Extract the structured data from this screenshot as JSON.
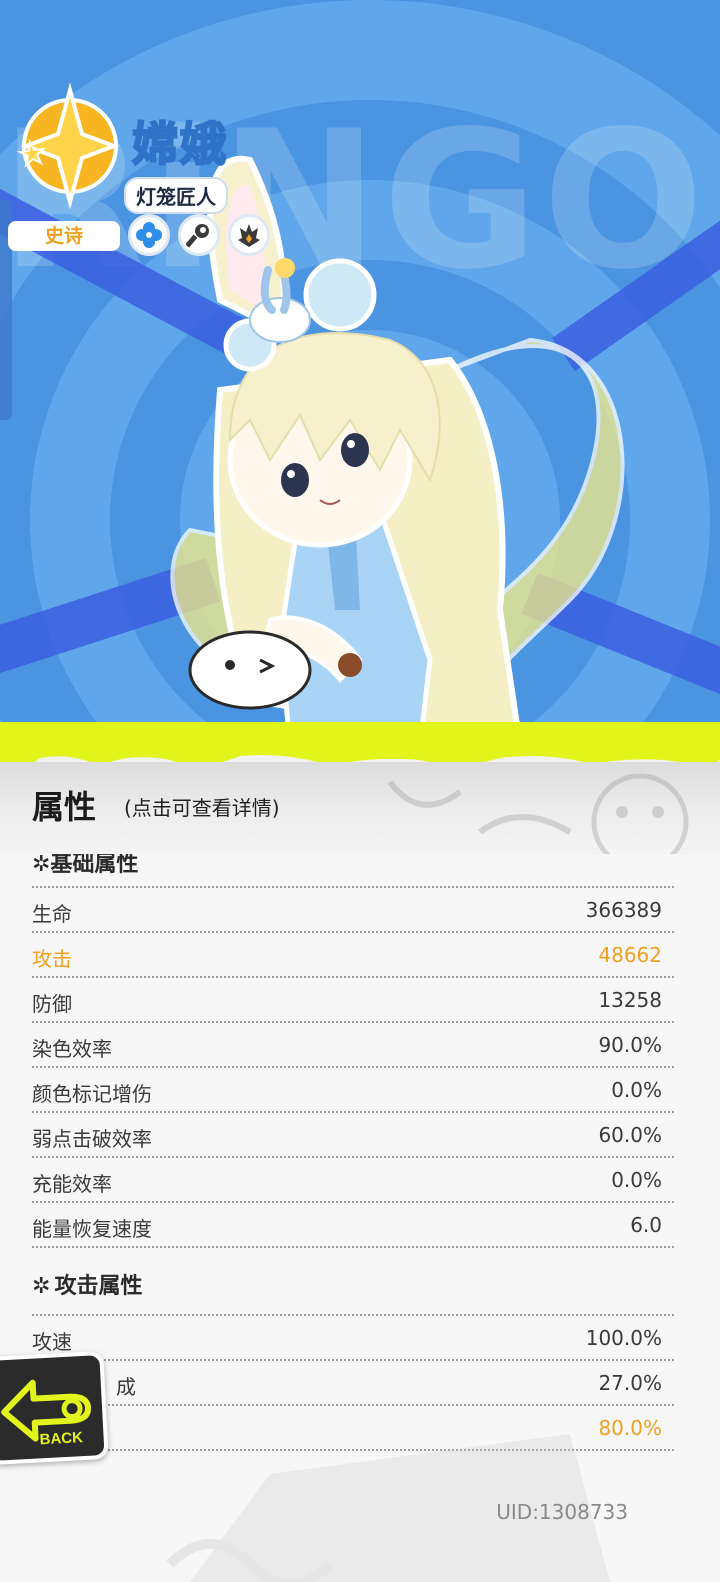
{
  "hero": {
    "bg_text": "RiNGOD",
    "character_name": "嫦娥",
    "character_title": "灯笼匠人",
    "rarity": "史诗",
    "colors": {
      "sky_blue": "#4a94e2",
      "streak": "#3b5ee0",
      "gold": "#f7b522"
    },
    "skills": [
      {
        "icon": "flower-skill-icon"
      },
      {
        "icon": "wrench-skill-icon"
      },
      {
        "icon": "flame-skill-icon"
      }
    ]
  },
  "panel": {
    "title": "属性",
    "subtitle": "(点击可查看详情)",
    "cut_heading": "✲基础属性",
    "basic_stats": [
      {
        "label": "生命",
        "value": "366389",
        "highlight": false
      },
      {
        "label": "攻击",
        "value": "48662",
        "highlight": true
      },
      {
        "label": "防御",
        "value": "13258",
        "highlight": false
      },
      {
        "label": "染色效率",
        "value": "90.0%",
        "highlight": false
      },
      {
        "label": "颜色标记增伤",
        "value": "0.0%",
        "highlight": false
      },
      {
        "label": "弱点击破效率",
        "value": "60.0%",
        "highlight": false
      },
      {
        "label": "充能效率",
        "value": "0.0%",
        "highlight": false
      },
      {
        "label": "能量恢复速度",
        "value": "6.0",
        "highlight": false
      }
    ],
    "attack_section_title": "攻击属性",
    "attack_stats": [
      {
        "label": "攻速",
        "value": "100.0%",
        "highlight": false
      },
      {
        "label": "成",
        "value": "27.0%",
        "highlight": false
      },
      {
        "label": "",
        "value": "80.0%",
        "highlight": true
      }
    ],
    "highlight_color": "#f0a020"
  },
  "back_button": {
    "label": "BACK"
  },
  "uid": "UID:1308733"
}
